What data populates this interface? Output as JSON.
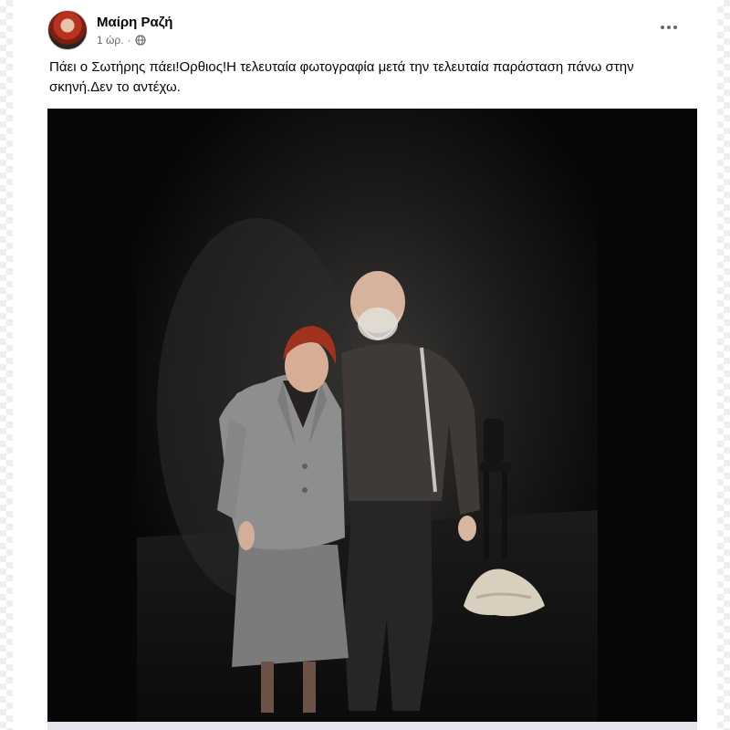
{
  "post": {
    "author": "Μαίρη Ραζή",
    "time": "1 ώρ.",
    "separator": "·",
    "audience_icon": "globe-icon",
    "caption": "Πάει ο Σωτήρης πάει!Ορθιος!Η τελευταία φωτογραφία μετά την τελευταία παράσταση πάνω στην σκηνή.Δεν το αντέχω.",
    "more_icon": "more-options-icon"
  },
  "colors": {
    "author_text": "#050505",
    "secondary_text": "#65676b",
    "photo_background": "#050505"
  }
}
